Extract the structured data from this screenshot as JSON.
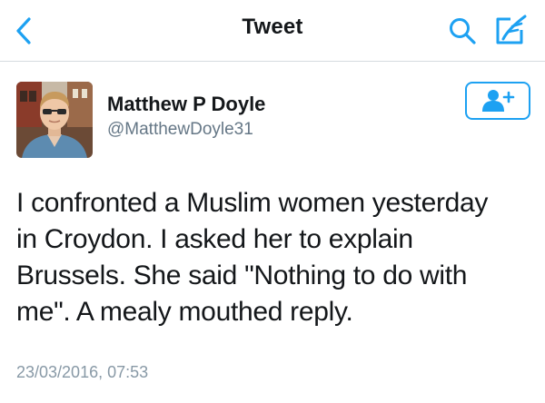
{
  "navbar": {
    "title": "Tweet",
    "back_icon": "chevron-left-icon",
    "search_icon": "search-icon",
    "compose_icon": "compose-icon"
  },
  "user": {
    "display_name": "Matthew P Doyle",
    "handle": "@MatthewDoyle31",
    "follow_icon": "add-user-icon"
  },
  "tweet": {
    "lines": [
      "I confronted a Muslim women yesterday",
      "in Croydon. I asked her to explain",
      "Brussels. She said \"Nothing to do with",
      "me\". A mealy mouthed reply."
    ],
    "timestamp": "23/03/2016, 07:53"
  },
  "colors": {
    "accent": "#1da1f2",
    "text": "#14171a",
    "secondary": "#657786",
    "timestamp": "#8899a6",
    "divider": "#d5dbe0"
  }
}
